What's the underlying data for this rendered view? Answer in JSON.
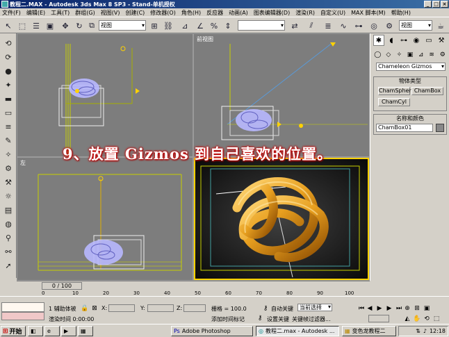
{
  "window": {
    "title": "教程二.MAX - Autodesk 3ds Max 8 SP3 - Stand-单机授权"
  },
  "menu": [
    "文件(F)",
    "编辑(E)",
    "工具(T)",
    "群组(G)",
    "视图(V)",
    "创建(C)",
    "修改器(O)",
    "角色(H)",
    "反应器",
    "动画(A)",
    "图表编辑器(D)",
    "渲染(R)",
    "自定义(U)",
    "MAX 脚本(M)",
    "帮助(H)"
  ],
  "toolbar": {
    "coord_system": "视图",
    "right_view_drop": "视图"
  },
  "viewports": {
    "front_label": "前视图",
    "left_label": "左"
  },
  "caption": "9、放置 Gizmos 到自己喜欢的位置。",
  "command_panel": {
    "category": "Chameleon Gizmos",
    "object_type_header": "物体类型",
    "btn_chamsphere": "ChamSphere",
    "btn_chambox": "ChamBox",
    "btn_chamcyl": "ChamCyl",
    "name_color_header": "名称和颜色",
    "name_value": "ChamBox01"
  },
  "timeline": {
    "slider": "0 / 100",
    "ticks": [
      "0",
      "10",
      "20",
      "30",
      "40",
      "50",
      "60",
      "70",
      "80",
      "90",
      "100"
    ]
  },
  "status": {
    "selection": "1 辅助体被",
    "x_label": "X:",
    "y_label": "Y:",
    "z_label": "Z:",
    "grid": "栅格 = 100.0",
    "autokey": "自动关键",
    "setkey": "设置关键",
    "selection_set": "当前选择",
    "key_filter": "关键帧过滤器...",
    "render_time": "渲染时间 0:00:00",
    "add_time_tag": "添加时间标记"
  },
  "taskbar": {
    "start": "开始",
    "tasks": [
      "教程二.max - Autodesk ...",
      "Adobe Photoshop",
      "变色龙教程二"
    ],
    "clock": "12:18"
  },
  "colors": {
    "gizmo": "#b8b8ff",
    "gold_object": "#e8a020",
    "grid_yellow": "#c8d000"
  }
}
